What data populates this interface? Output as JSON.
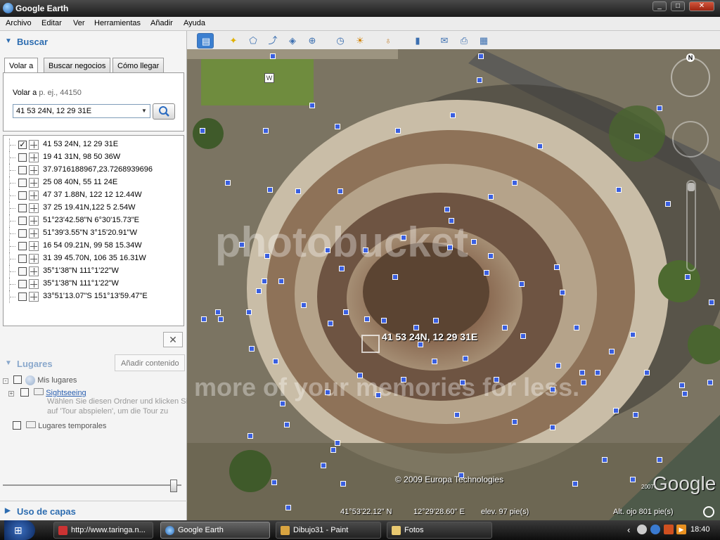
{
  "window": {
    "title": "Google Earth",
    "minimize": "_",
    "maximize": "□",
    "close": "✕"
  },
  "menu": [
    "Archivo",
    "Editar",
    "Ver",
    "Herramientas",
    "Añadir",
    "Ayuda"
  ],
  "search": {
    "header": "Buscar",
    "tabs": [
      "Volar a",
      "Buscar negocios",
      "Cómo llegar"
    ],
    "hint_prefix": "Volar a",
    "hint_example": "p. ej., 44150",
    "input_value": "41 53 24N, 12 29 31E"
  },
  "results": [
    {
      "label": "41 53 24N, 12 29 31E",
      "checked": true
    },
    {
      "label": "19 41 31N, 98 50 36W",
      "checked": false
    },
    {
      "label": "37.9716188967,23.7268939696",
      "checked": false
    },
    {
      "label": "25 08 40N, 55 11 24E",
      "checked": false
    },
    {
      "label": "47 37 1.88N, 122 12 12.44W",
      "checked": false
    },
    {
      "label": "37 25 19.41N,122 5 2.54W",
      "checked": false
    },
    {
      "label": "51°23'42.58\"N 6°30'15.73\"E",
      "checked": false
    },
    {
      "label": "51°39'3.55\"N 3°15'20.91\"W",
      "checked": false
    },
    {
      "label": "16 54 09.21N, 99 58 15.34W",
      "checked": false
    },
    {
      "label": "31 39 45.70N, 106 35 16.31W",
      "checked": false
    },
    {
      "label": "35°1'38\"N 111°1'22\"W",
      "checked": false
    },
    {
      "label": "35°1'38\"N 111°1'22\"W",
      "checked": false
    },
    {
      "label": "33°51'13.07\"S 151°13'59.47\"E",
      "checked": false
    }
  ],
  "close_label": "✕",
  "places": {
    "header": "Lugares",
    "add_content": "Añadir contenido",
    "my_places": "Mis lugares",
    "sightseeing": "Sightseeing",
    "sightseeing_desc1": "Wählen Sie diesen Ordner und klicken Sie",
    "sightseeing_desc2": "auf 'Tour abspielen', um die Tour zu",
    "temp_places": "Lugares temporales"
  },
  "layers": {
    "header": "Uso de capas"
  },
  "map": {
    "placemark_label": "41 53 24N, 12 29 31E",
    "copyright": "© 2009 Europa Technologies",
    "brand": "Google",
    "brand_sup": "2007",
    "watermark1": "photobucket",
    "watermark2": "more of your memories for less.",
    "status_lat": "41°53'22.12\" N",
    "status_lon": "12°29'28.60\" E",
    "status_elev": "elev.   97 pie(s)",
    "status_eye": "Alt. ojo    801 pie(s)",
    "compass_n": "N",
    "road_sign": "W"
  },
  "taskbar": {
    "tasks": [
      "http://www.taringa.n...",
      "Google Earth",
      "Dibujo31 - Paint",
      "Fotos"
    ],
    "clock": "18:40",
    "tray_arrow": "‹"
  }
}
